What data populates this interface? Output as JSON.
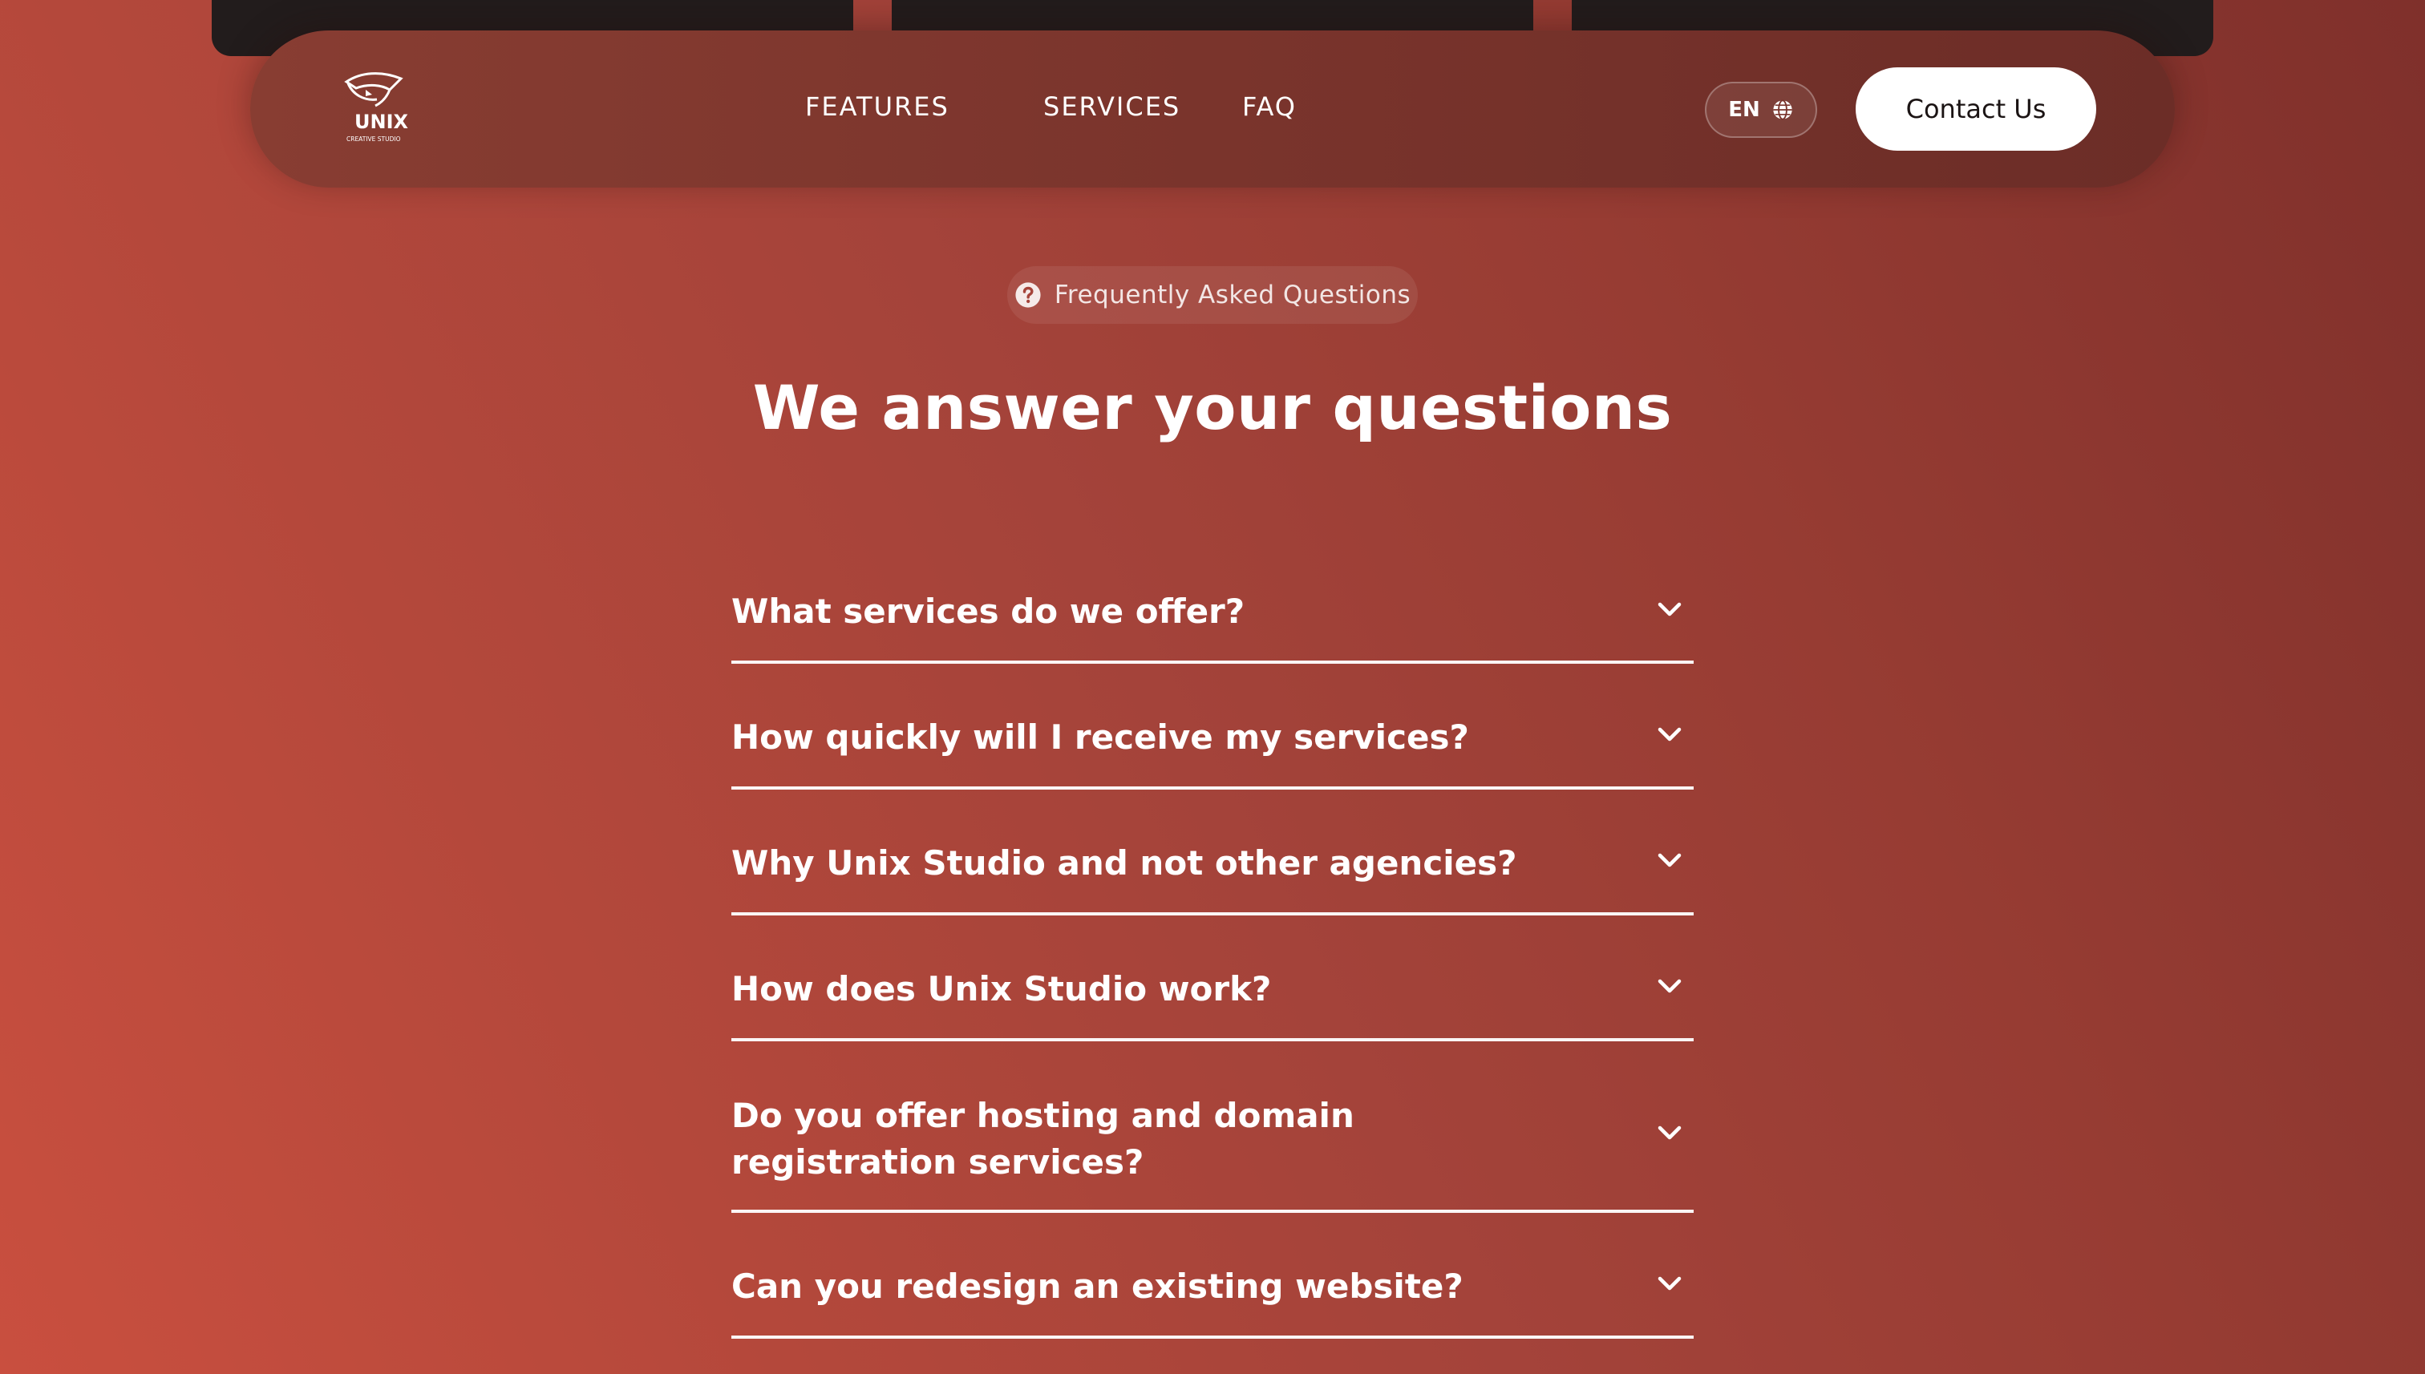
{
  "nav": {
    "logo": {
      "icon": "unix-creative-studio-logo",
      "brand": "UNIX",
      "tagline": "CREATIVE STUDIO"
    },
    "links": [
      {
        "label": "FEATURES"
      },
      {
        "label": "SERVICES"
      },
      {
        "label": "FAQ"
      }
    ],
    "language": {
      "label": "EN",
      "icon": "globe-icon"
    },
    "contact_label": "Contact Us"
  },
  "faq": {
    "badge_label": "Frequently Asked Questions",
    "badge_icon": "question-circle-icon",
    "headline": "We answer your questions",
    "items": [
      {
        "question": "What services do we offer?",
        "icon": "chevron-down-icon"
      },
      {
        "question": "How quickly will I receive my services?",
        "icon": "chevron-down-icon"
      },
      {
        "question": "Why Unix Studio and not other agencies?",
        "icon": "chevron-down-icon"
      },
      {
        "question": "How does Unix Studio work?",
        "icon": "chevron-down-icon"
      },
      {
        "question": "Do you offer hosting and domain registration services?",
        "icon": "chevron-down-icon"
      },
      {
        "question": "Can you redesign an existing website?",
        "icon": "chevron-down-icon"
      }
    ]
  },
  "colors": {
    "background_start": "#c94f3f",
    "background_end": "#7f302b",
    "navbar": "#7a342c",
    "card_dark": "#221c1c",
    "button_bg": "#ffffff",
    "button_text": "#1b1414"
  }
}
